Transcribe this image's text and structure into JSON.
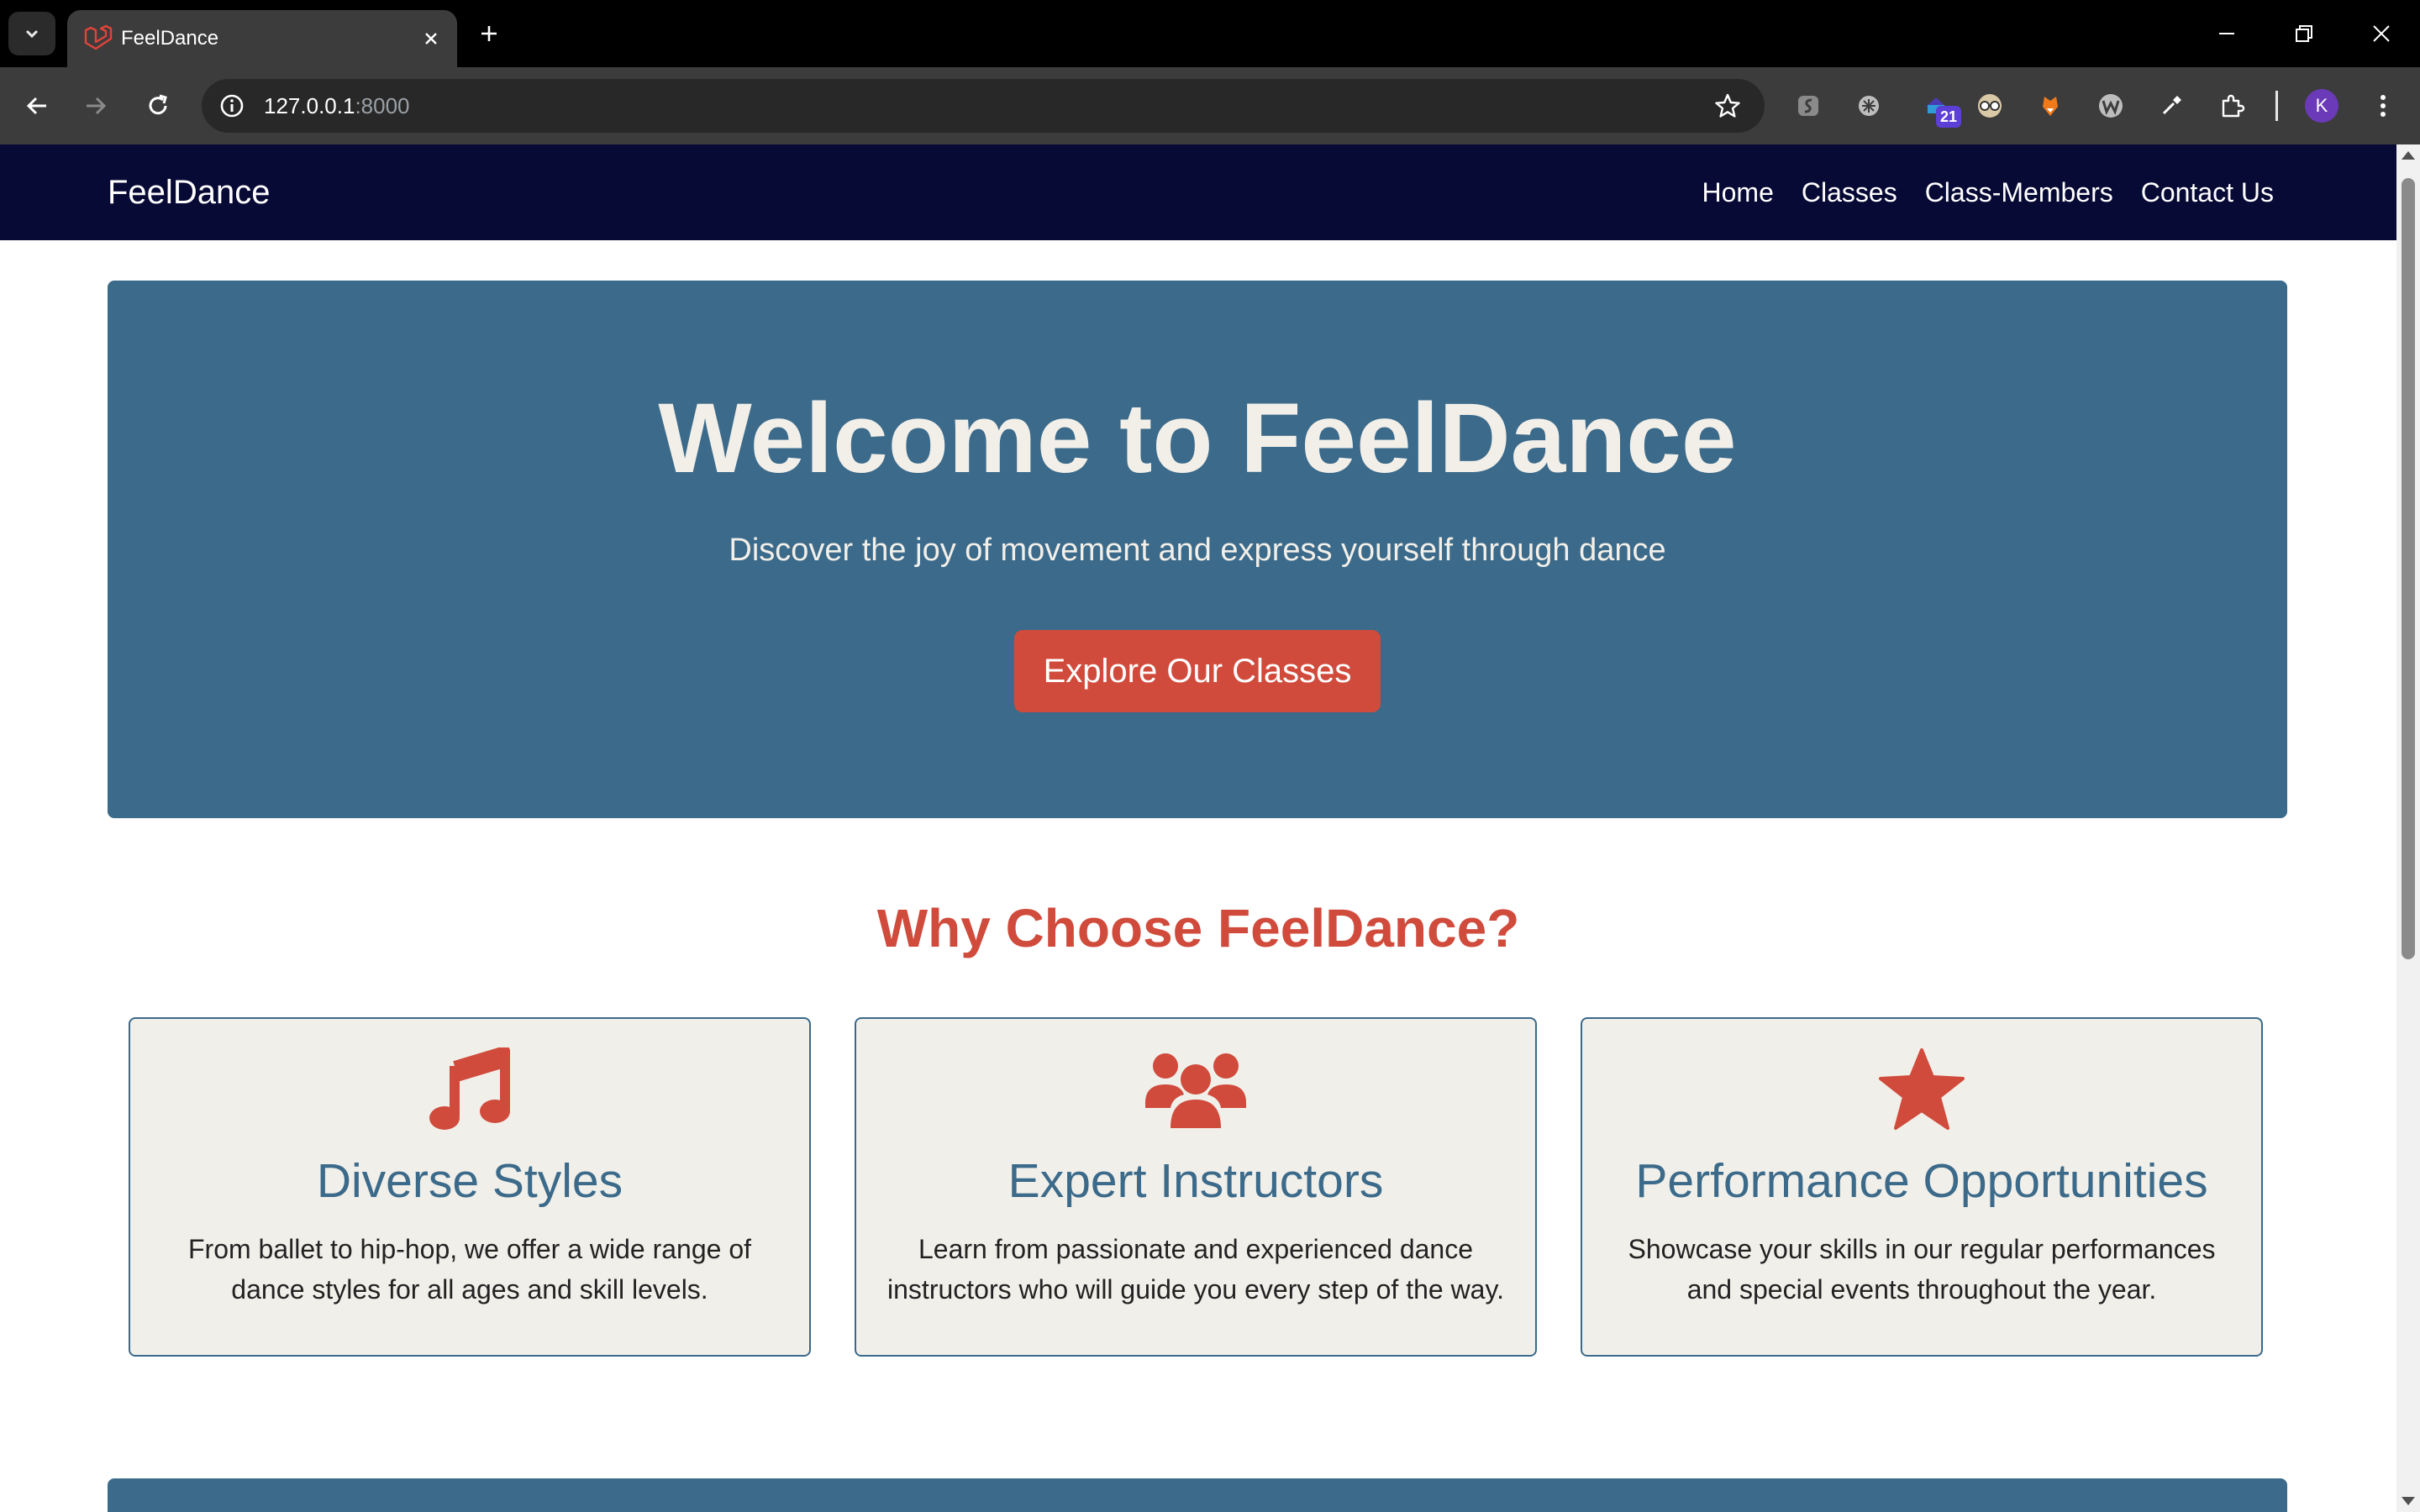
{
  "browser": {
    "tab_title": "FeelDance",
    "url_host": "127.0.0.1",
    "url_port": ":8000",
    "extension_badge": "21",
    "profile_initial": "K"
  },
  "site": {
    "brand": "FeelDance",
    "nav": [
      "Home",
      "Classes",
      "Class-Members",
      "Contact Us"
    ]
  },
  "hero": {
    "title": "Welcome to FeelDance",
    "subtitle": "Discover the joy of movement and express yourself through dance",
    "cta": "Explore Our Classes"
  },
  "why": {
    "title": "Why Choose FeelDance?",
    "features": [
      {
        "icon": "music-note-icon",
        "title": "Diverse Styles",
        "text": "From ballet to hip-hop, we offer a wide range of dance styles for all ages and skill levels."
      },
      {
        "icon": "users-group-icon",
        "title": "Expert Instructors",
        "text": "Learn from passionate and experienced dance instructors who will guide you every step of the way."
      },
      {
        "icon": "star-icon",
        "title": "Performance Opportunities",
        "text": "Showcase your skills in our regular performances and special events throughout the year."
      }
    ]
  },
  "colors": {
    "nav_bg": "#080a36",
    "hero_bg": "#3b6a8a",
    "accent": "#d04b3c",
    "card_bg": "#f1efe9",
    "text_light": "#f2efe9"
  }
}
